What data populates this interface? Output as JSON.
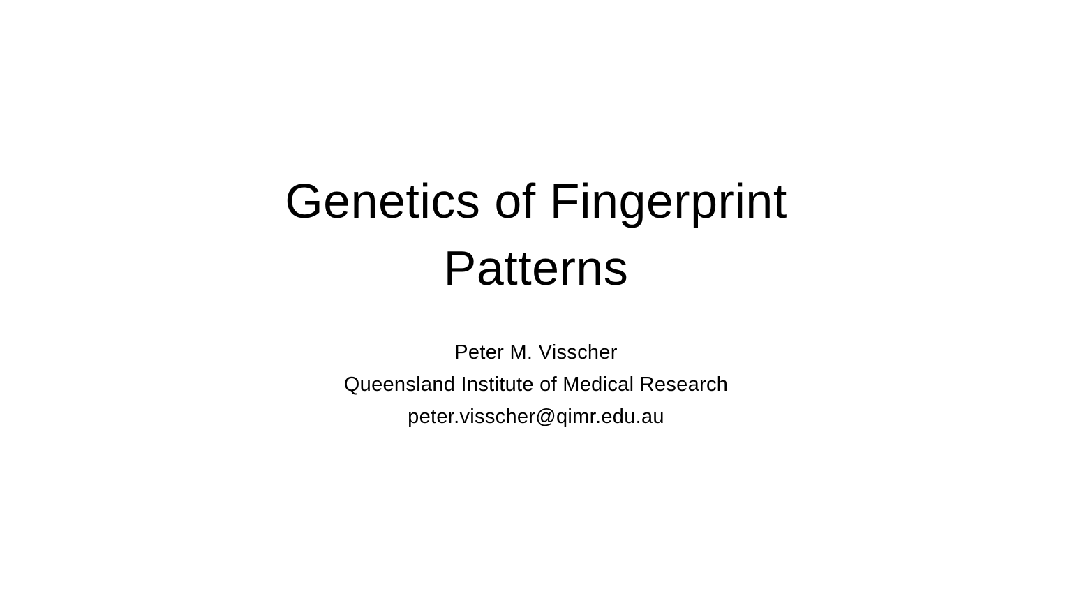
{
  "slide": {
    "title_lines": [
      "Genetics of Fingerprint",
      "Patterns"
    ],
    "author": "Peter M. Visscher",
    "institution": "Queensland Institute of Medical Research",
    "email": "peter.visscher@qimr.edu.au"
  }
}
